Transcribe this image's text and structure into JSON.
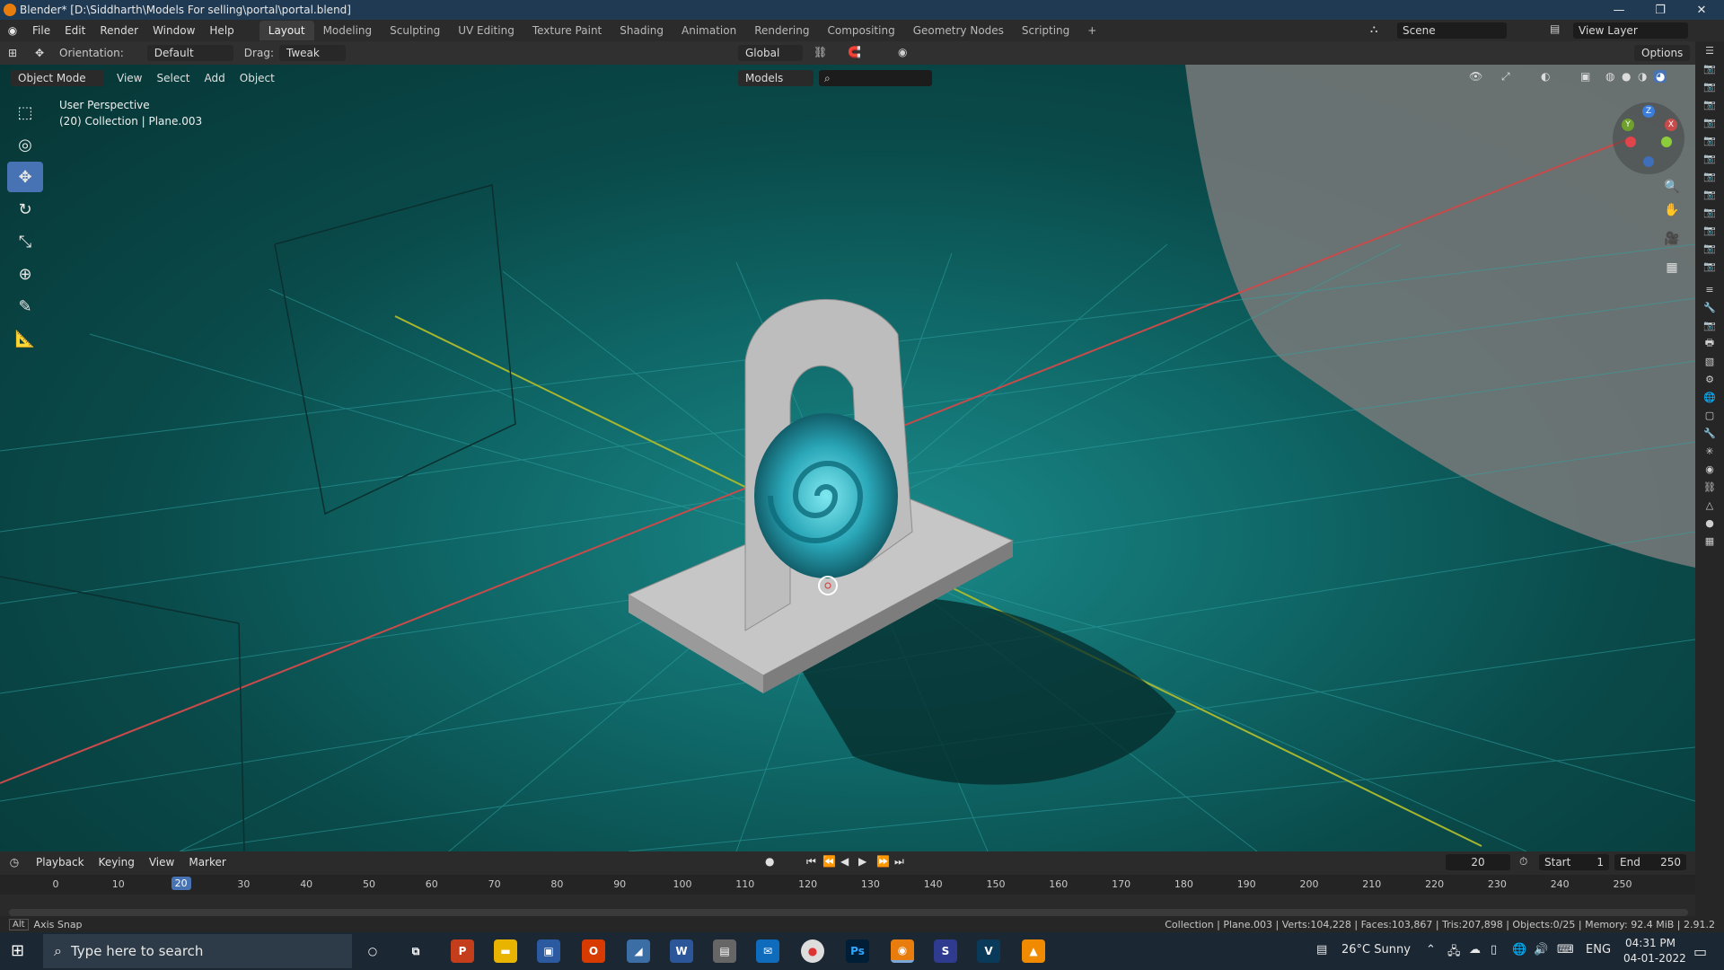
{
  "window": {
    "title": "Blender* [D:\\Siddharth\\Models For selling\\portal\\portal.blend]",
    "controls": [
      "—",
      "❐",
      "✕"
    ]
  },
  "menu": {
    "items": [
      "File",
      "Edit",
      "Render",
      "Window",
      "Help"
    ],
    "workspaces": [
      "Layout",
      "Modeling",
      "Sculpting",
      "UV Editing",
      "Texture Paint",
      "Shading",
      "Animation",
      "Rendering",
      "Compositing",
      "Geometry Nodes",
      "Scripting"
    ],
    "active_workspace": "Layout",
    "add_tab": "+",
    "scene": "Scene",
    "view_layer": "View Layer"
  },
  "tool_header": {
    "orientation_label": "Orientation:",
    "orientation_value": "Default",
    "drag_label": "Drag:",
    "drag_value": "Tweak",
    "transform_orientation": "Global",
    "options": "Options"
  },
  "viewport_header": {
    "mode": "Object Mode",
    "menus": [
      "View",
      "Select",
      "Add",
      "Object"
    ],
    "collection_filter": "Models"
  },
  "viewport": {
    "perspective": "User Perspective",
    "collection_info": "(20) Collection | Plane.003"
  },
  "gizmo": {
    "x": "X",
    "y": "Y",
    "z": "Z"
  },
  "toolbar": {
    "tools": [
      "select-box-icon",
      "cursor-icon",
      "move-icon",
      "rotate-icon",
      "scale-icon",
      "transform-icon",
      "annotate-icon",
      "measure-icon"
    ],
    "active": "move-icon"
  },
  "timeline": {
    "menus": [
      "Playback",
      "Keying",
      "View",
      "Marker"
    ],
    "current_frame": "20",
    "start_label": "Start",
    "start_value": "1",
    "end_label": "End",
    "end_value": "250",
    "ticks": [
      "0",
      "10",
      "20",
      "30",
      "40",
      "50",
      "60",
      "70",
      "80",
      "90",
      "100",
      "110",
      "120",
      "130",
      "140",
      "150",
      "160",
      "170",
      "180",
      "190",
      "200",
      "210",
      "220",
      "230",
      "240",
      "250"
    ],
    "playback_controls": [
      "⏮",
      "⏪",
      "◀",
      "▶",
      "⏩",
      "⏭"
    ]
  },
  "statusbar": {
    "left": "Axis Snap",
    "stats": "Collection | Plane.003 | Verts:104,228 | Faces:103,867 | Tris:207,898 | Objects:0/25 | Memory: 92.4 MiB | 2.91.2"
  },
  "taskbar": {
    "search_placeholder": "Type here to search",
    "weather": "26°C  Sunny",
    "language": "ENG",
    "time": "04:31 PM",
    "date": "04-01-2022"
  },
  "colors": {
    "accent": "#4772b3",
    "viewport_bg": "#0f6565",
    "x_axis": "#c84b4b",
    "y_axis": "#a7b62f"
  }
}
